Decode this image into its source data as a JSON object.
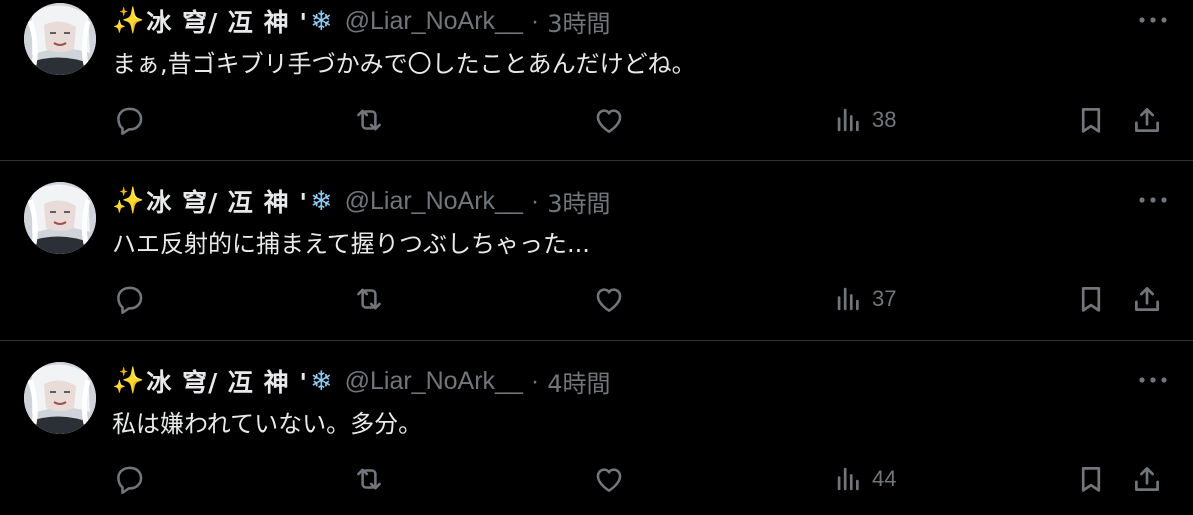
{
  "colors": {
    "background": "#000000",
    "text_primary": "#e7e9ea",
    "text_secondary": "#71767b",
    "divider": "#2f3336",
    "sparkle": "#f7c948",
    "snowflake": "#8ecbf5"
  },
  "tweets": [
    {
      "display_name": "冰 穹/ 冱 神 '",
      "name_prefix_emoji": "✨",
      "name_suffix_emoji": "❄",
      "handle": "@Liar_NoArk__",
      "separator": "·",
      "time": "3時間",
      "text": "まぁ,昔ゴキブリ手づかみで〇したことあんだけどね。",
      "views": "38"
    },
    {
      "display_name": "冰 穹/ 冱 神 '",
      "name_prefix_emoji": "✨",
      "name_suffix_emoji": "❄",
      "handle": "@Liar_NoArk__",
      "separator": "·",
      "time": "3時間",
      "text": "ハエ反射的に捕まえて握りつぶしちゃった...",
      "views": "37"
    },
    {
      "display_name": "冰 穹/ 冱 神 '",
      "name_prefix_emoji": "✨",
      "name_suffix_emoji": "❄",
      "handle": "@Liar_NoArk__",
      "separator": "·",
      "time": "4時間",
      "text": "私は嫌われていない。多分。",
      "views": "44"
    }
  ],
  "icons": {
    "more": "more-horizontal-icon",
    "reply": "reply-icon",
    "retweet": "retweet-icon",
    "like": "heart-icon",
    "views": "views-chart-icon",
    "bookmark": "bookmark-icon",
    "share": "share-icon"
  }
}
